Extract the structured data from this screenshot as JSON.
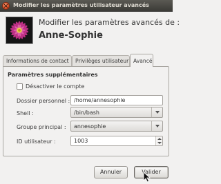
{
  "window": {
    "title": "Modifier les paramètres utilisateur avancés"
  },
  "header": {
    "heading": "Modifier les paramètres avancés de :",
    "username": "Anne-Sophie"
  },
  "tabs": [
    {
      "label": "Informations de contact",
      "active": false
    },
    {
      "label": "Privilèges utilisateur",
      "active": false
    },
    {
      "label": "Avancé",
      "active": true
    }
  ],
  "advanced": {
    "section_title": "Paramètres supplémentaires",
    "disable_account": {
      "label": "Désactiver le compte",
      "checked": false
    },
    "home_dir": {
      "label": "Dossier personnel :",
      "value": "/home/annesophie"
    },
    "shell": {
      "label": "Shell :",
      "value": "/bin/bash"
    },
    "main_group": {
      "label": "Groupe principal :",
      "value": "annesophie"
    },
    "user_id": {
      "label": "ID utilisateur :",
      "value": "1003"
    }
  },
  "buttons": {
    "cancel": "Annuler",
    "ok": "Valider"
  },
  "colors": {
    "titlebar": "#3c3b37",
    "close_button": "#e0512a",
    "window_bg": "#f2f1f0"
  }
}
